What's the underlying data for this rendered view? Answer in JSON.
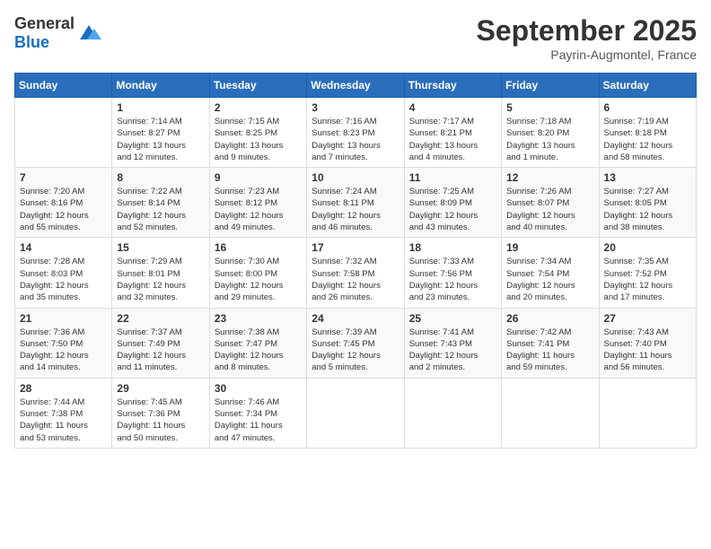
{
  "header": {
    "logo_general": "General",
    "logo_blue": "Blue",
    "month": "September 2025",
    "location": "Payrin-Augmontel, France"
  },
  "days_of_week": [
    "Sunday",
    "Monday",
    "Tuesday",
    "Wednesday",
    "Thursday",
    "Friday",
    "Saturday"
  ],
  "weeks": [
    [
      {
        "day": "",
        "info": ""
      },
      {
        "day": "1",
        "info": "Sunrise: 7:14 AM\nSunset: 8:27 PM\nDaylight: 13 hours\nand 12 minutes."
      },
      {
        "day": "2",
        "info": "Sunrise: 7:15 AM\nSunset: 8:25 PM\nDaylight: 13 hours\nand 9 minutes."
      },
      {
        "day": "3",
        "info": "Sunrise: 7:16 AM\nSunset: 8:23 PM\nDaylight: 13 hours\nand 7 minutes."
      },
      {
        "day": "4",
        "info": "Sunrise: 7:17 AM\nSunset: 8:21 PM\nDaylight: 13 hours\nand 4 minutes."
      },
      {
        "day": "5",
        "info": "Sunrise: 7:18 AM\nSunset: 8:20 PM\nDaylight: 13 hours\nand 1 minute."
      },
      {
        "day": "6",
        "info": "Sunrise: 7:19 AM\nSunset: 8:18 PM\nDaylight: 12 hours\nand 58 minutes."
      }
    ],
    [
      {
        "day": "7",
        "info": "Sunrise: 7:20 AM\nSunset: 8:16 PM\nDaylight: 12 hours\nand 55 minutes."
      },
      {
        "day": "8",
        "info": "Sunrise: 7:22 AM\nSunset: 8:14 PM\nDaylight: 12 hours\nand 52 minutes."
      },
      {
        "day": "9",
        "info": "Sunrise: 7:23 AM\nSunset: 8:12 PM\nDaylight: 12 hours\nand 49 minutes."
      },
      {
        "day": "10",
        "info": "Sunrise: 7:24 AM\nSunset: 8:11 PM\nDaylight: 12 hours\nand 46 minutes."
      },
      {
        "day": "11",
        "info": "Sunrise: 7:25 AM\nSunset: 8:09 PM\nDaylight: 12 hours\nand 43 minutes."
      },
      {
        "day": "12",
        "info": "Sunrise: 7:26 AM\nSunset: 8:07 PM\nDaylight: 12 hours\nand 40 minutes."
      },
      {
        "day": "13",
        "info": "Sunrise: 7:27 AM\nSunset: 8:05 PM\nDaylight: 12 hours\nand 38 minutes."
      }
    ],
    [
      {
        "day": "14",
        "info": "Sunrise: 7:28 AM\nSunset: 8:03 PM\nDaylight: 12 hours\nand 35 minutes."
      },
      {
        "day": "15",
        "info": "Sunrise: 7:29 AM\nSunset: 8:01 PM\nDaylight: 12 hours\nand 32 minutes."
      },
      {
        "day": "16",
        "info": "Sunrise: 7:30 AM\nSunset: 8:00 PM\nDaylight: 12 hours\nand 29 minutes."
      },
      {
        "day": "17",
        "info": "Sunrise: 7:32 AM\nSunset: 7:58 PM\nDaylight: 12 hours\nand 26 minutes."
      },
      {
        "day": "18",
        "info": "Sunrise: 7:33 AM\nSunset: 7:56 PM\nDaylight: 12 hours\nand 23 minutes."
      },
      {
        "day": "19",
        "info": "Sunrise: 7:34 AM\nSunset: 7:54 PM\nDaylight: 12 hours\nand 20 minutes."
      },
      {
        "day": "20",
        "info": "Sunrise: 7:35 AM\nSunset: 7:52 PM\nDaylight: 12 hours\nand 17 minutes."
      }
    ],
    [
      {
        "day": "21",
        "info": "Sunrise: 7:36 AM\nSunset: 7:50 PM\nDaylight: 12 hours\nand 14 minutes."
      },
      {
        "day": "22",
        "info": "Sunrise: 7:37 AM\nSunset: 7:49 PM\nDaylight: 12 hours\nand 11 minutes."
      },
      {
        "day": "23",
        "info": "Sunrise: 7:38 AM\nSunset: 7:47 PM\nDaylight: 12 hours\nand 8 minutes."
      },
      {
        "day": "24",
        "info": "Sunrise: 7:39 AM\nSunset: 7:45 PM\nDaylight: 12 hours\nand 5 minutes."
      },
      {
        "day": "25",
        "info": "Sunrise: 7:41 AM\nSunset: 7:43 PM\nDaylight: 12 hours\nand 2 minutes."
      },
      {
        "day": "26",
        "info": "Sunrise: 7:42 AM\nSunset: 7:41 PM\nDaylight: 11 hours\nand 59 minutes."
      },
      {
        "day": "27",
        "info": "Sunrise: 7:43 AM\nSunset: 7:40 PM\nDaylight: 11 hours\nand 56 minutes."
      }
    ],
    [
      {
        "day": "28",
        "info": "Sunrise: 7:44 AM\nSunset: 7:38 PM\nDaylight: 11 hours\nand 53 minutes."
      },
      {
        "day": "29",
        "info": "Sunrise: 7:45 AM\nSunset: 7:36 PM\nDaylight: 11 hours\nand 50 minutes."
      },
      {
        "day": "30",
        "info": "Sunrise: 7:46 AM\nSunset: 7:34 PM\nDaylight: 11 hours\nand 47 minutes."
      },
      {
        "day": "",
        "info": ""
      },
      {
        "day": "",
        "info": ""
      },
      {
        "day": "",
        "info": ""
      },
      {
        "day": "",
        "info": ""
      }
    ]
  ]
}
